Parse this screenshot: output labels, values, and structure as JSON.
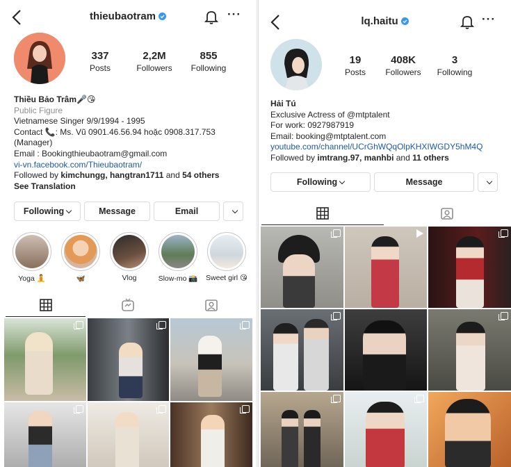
{
  "left": {
    "username": "thieubaotram",
    "stats": [
      {
        "num": "337",
        "label": "Posts"
      },
      {
        "num": "2,2M",
        "label": "Followers"
      },
      {
        "num": "855",
        "label": "Following"
      }
    ],
    "bio": {
      "name": "Thiều Bảo Trâm🎤😘",
      "category": "Public Figure",
      "line1": "Vietnamese Singer 9/9/1994 - 1995",
      "line2": "Contact 📞: Ms. Vũ 0901.46.56.94 hoặc 0908.317.753",
      "line3": "(Manager)",
      "line4": "Email : Bookingthieubaotram@gmail.com",
      "link": "vi-vn.facebook.com/Thieubaotram/",
      "followed_prefix": "Followed by ",
      "followed_names": "kimchungg, hangtran1711",
      "followed_and": " and ",
      "followed_others": "54 others",
      "translation": "See Translation"
    },
    "buttons": {
      "following": "Following",
      "message": "Message",
      "email": "Email"
    },
    "highlights": [
      "Yoga 🧘",
      "🦋",
      "Vlog",
      "Slow-mo 📸",
      "Sweet girl 😘"
    ]
  },
  "right": {
    "username": "lq.haitu",
    "stats": [
      {
        "num": "19",
        "label": "Posts"
      },
      {
        "num": "408K",
        "label": "Followers"
      },
      {
        "num": "3",
        "label": "Following"
      }
    ],
    "bio": {
      "name": "Hải Tú",
      "line1": "Exclusive Actress of @mtptalent",
      "line2": "For work: 0927987919",
      "line3": "Email: booking@mtptalent.com",
      "link": "youtube.com/channel/UCrGhWQqOlpKHXIWGDY5hM4Q",
      "followed_prefix": "Followed by ",
      "followed_names": "imtrang.97, manhbi",
      "followed_and": " and ",
      "followed_others": "11 others"
    },
    "buttons": {
      "following": "Following",
      "message": "Message"
    }
  },
  "colors": {
    "verified": "#3897f0",
    "link": "#1d5aa7",
    "secondary": "#8e8e8e",
    "border": "#dbdbdb"
  }
}
